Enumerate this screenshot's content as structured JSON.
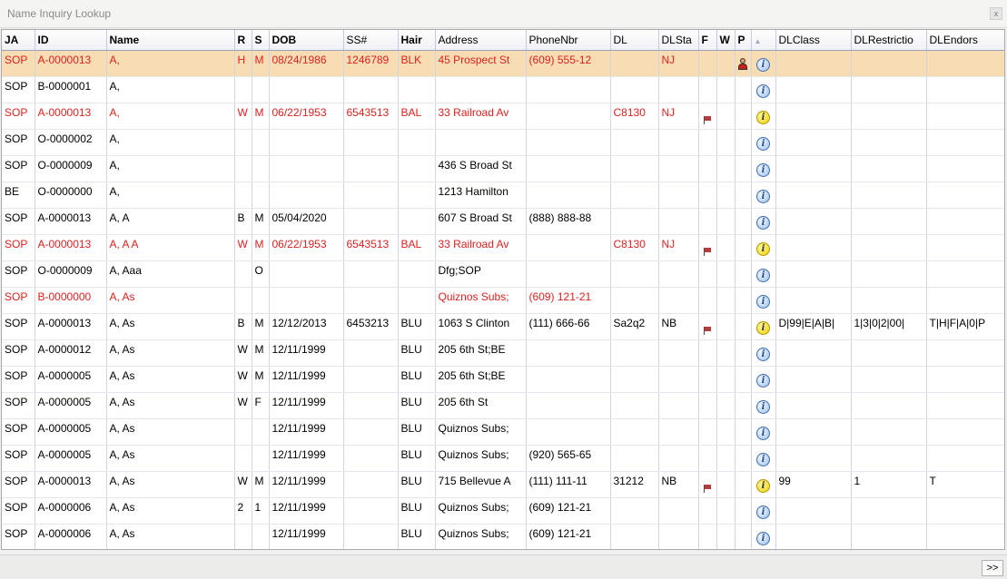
{
  "window": {
    "title": "Name Inquiry Lookup",
    "close_label": "x"
  },
  "colors": {
    "selected_row": "#f8dcb4",
    "alert_text": "#e0201e"
  },
  "columns": [
    {
      "label": "JA",
      "bold": true
    },
    {
      "label": "ID",
      "bold": true
    },
    {
      "label": "Name",
      "bold": true
    },
    {
      "label": "R",
      "bold": true
    },
    {
      "label": "S",
      "bold": true
    },
    {
      "label": "DOB",
      "bold": true
    },
    {
      "label": "SS#",
      "bold": false
    },
    {
      "label": "Hair",
      "bold": true
    },
    {
      "label": "Address",
      "bold": false
    },
    {
      "label": "PhoneNbr",
      "bold": false
    },
    {
      "label": "DL",
      "bold": false
    },
    {
      "label": "DLSta",
      "bold": false
    },
    {
      "label": "F",
      "bold": true
    },
    {
      "label": "W",
      "bold": true
    },
    {
      "label": "P",
      "bold": true
    },
    {
      "label": "",
      "bold": false,
      "sort_icon": "sort-ascending-icon"
    },
    {
      "label": "DLClass",
      "bold": false
    },
    {
      "label": "DLRestrictio",
      "bold": false
    },
    {
      "label": "DLEndors",
      "bold": false
    }
  ],
  "rows": [
    {
      "style": "selected-red",
      "ja": "SOP",
      "id": "A-0000013",
      "name": "A,",
      "r": "H",
      "s": "M",
      "dob": "08/24/1986",
      "ss": "1246789",
      "hair": "BLK",
      "address": "45 Prospect St",
      "phone": "(609) 555-12",
      "dl": "",
      "dlsta": "NJ",
      "f": "",
      "w": "",
      "p": "person-icon",
      "info": "blue",
      "dlclass": "",
      "dlrestr": "",
      "dlendors": ""
    },
    {
      "style": "normal",
      "ja": "SOP",
      "id": "B-0000001",
      "name": "A,",
      "r": "",
      "s": "",
      "dob": "",
      "ss": "",
      "hair": "",
      "address": "",
      "phone": "",
      "dl": "",
      "dlsta": "",
      "f": "",
      "w": "",
      "p": "",
      "info": "blue",
      "dlclass": "",
      "dlrestr": "",
      "dlendors": ""
    },
    {
      "style": "red",
      "ja": "SOP",
      "id": "A-0000013",
      "name": "A,",
      "r": "W",
      "s": "M",
      "dob": "06/22/1953",
      "ss": "6543513",
      "hair": "BAL",
      "address": "33 Railroad Av",
      "phone": "",
      "dl": "C8130",
      "dlsta": "NJ",
      "f": "flag-icon",
      "w": "",
      "p": "",
      "info": "yellow",
      "dlclass": "",
      "dlrestr": "",
      "dlendors": ""
    },
    {
      "style": "normal",
      "ja": "SOP",
      "id": "O-0000002",
      "name": "A,",
      "r": "",
      "s": "",
      "dob": "",
      "ss": "",
      "hair": "",
      "address": "",
      "phone": "",
      "dl": "",
      "dlsta": "",
      "f": "",
      "w": "",
      "p": "",
      "info": "blue",
      "dlclass": "",
      "dlrestr": "",
      "dlendors": ""
    },
    {
      "style": "normal",
      "ja": "SOP",
      "id": "O-0000009",
      "name": "A,",
      "r": "",
      "s": "",
      "dob": "",
      "ss": "",
      "hair": "",
      "address": "436 S Broad St",
      "phone": "",
      "dl": "",
      "dlsta": "",
      "f": "",
      "w": "",
      "p": "",
      "info": "blue",
      "dlclass": "",
      "dlrestr": "",
      "dlendors": ""
    },
    {
      "style": "normal",
      "ja": "BE",
      "id": "O-0000000",
      "name": "A,",
      "r": "",
      "s": "",
      "dob": "",
      "ss": "",
      "hair": "",
      "address": "1213 Hamilton",
      "phone": "",
      "dl": "",
      "dlsta": "",
      "f": "",
      "w": "",
      "p": "",
      "info": "blue",
      "dlclass": "",
      "dlrestr": "",
      "dlendors": ""
    },
    {
      "style": "normal",
      "ja": "SOP",
      "id": "A-0000013",
      "name": "A, A",
      "r": "B",
      "s": "M",
      "dob": "05/04/2020",
      "ss": "",
      "hair": "",
      "address": "607 S Broad St",
      "phone": "(888) 888-88",
      "dl": "",
      "dlsta": "",
      "f": "",
      "w": "",
      "p": "",
      "info": "blue",
      "dlclass": "",
      "dlrestr": "",
      "dlendors": ""
    },
    {
      "style": "red",
      "ja": "SOP",
      "id": "A-0000013",
      "name": "A, A A",
      "r": "W",
      "s": "M",
      "dob": "06/22/1953",
      "ss": "6543513",
      "hair": "BAL",
      "address": "33 Railroad Av",
      "phone": "",
      "dl": "C8130",
      "dlsta": "NJ",
      "f": "flag-icon",
      "w": "",
      "p": "",
      "info": "yellow",
      "dlclass": "",
      "dlrestr": "",
      "dlendors": ""
    },
    {
      "style": "normal",
      "ja": "SOP",
      "id": "O-0000009",
      "name": "A, Aaa",
      "r": "",
      "s": "O",
      "dob": "",
      "ss": "",
      "hair": "",
      "address": "Dfg;SOP",
      "phone": "",
      "dl": "",
      "dlsta": "",
      "f": "",
      "w": "",
      "p": "",
      "info": "blue",
      "dlclass": "",
      "dlrestr": "",
      "dlendors": ""
    },
    {
      "style": "red",
      "ja": "SOP",
      "id": "B-0000000",
      "name": "A, As",
      "r": "",
      "s": "",
      "dob": "",
      "ss": "",
      "hair": "",
      "address": "Quiznos Subs;",
      "phone": "(609) 121-21",
      "dl": "",
      "dlsta": "",
      "f": "",
      "w": "",
      "p": "",
      "info": "blue",
      "dlclass": "",
      "dlrestr": "",
      "dlendors": ""
    },
    {
      "style": "normal",
      "ja": "SOP",
      "id": "A-0000013",
      "name": "A, As",
      "r": "B",
      "s": "M",
      "dob": "12/12/2013",
      "ss": "6453213",
      "hair": "BLU",
      "address": "1063 S Clinton",
      "phone": "(111) 666-66",
      "dl": "Sa2q2",
      "dlsta": "NB",
      "f": "flag-icon",
      "w": "",
      "p": "",
      "info": "yellow",
      "dlclass": "D|99|E|A|B|",
      "dlrestr": "1|3|0|2|00|",
      "dlendors": "T|H|F|A|0|P"
    },
    {
      "style": "normal",
      "ja": "SOP",
      "id": "A-0000012",
      "name": "A, As",
      "r": "W",
      "s": "M",
      "dob": "12/11/1999",
      "ss": "",
      "hair": "BLU",
      "address": "205 6th St;BE",
      "phone": "",
      "dl": "",
      "dlsta": "",
      "f": "",
      "w": "",
      "p": "",
      "info": "blue",
      "dlclass": "",
      "dlrestr": "",
      "dlendors": ""
    },
    {
      "style": "normal",
      "ja": "SOP",
      "id": "A-0000005",
      "name": "A, As",
      "r": "W",
      "s": "M",
      "dob": "12/11/1999",
      "ss": "",
      "hair": "BLU",
      "address": "205 6th St;BE",
      "phone": "",
      "dl": "",
      "dlsta": "",
      "f": "",
      "w": "",
      "p": "",
      "info": "blue",
      "dlclass": "",
      "dlrestr": "",
      "dlendors": ""
    },
    {
      "style": "normal",
      "ja": "SOP",
      "id": "A-0000005",
      "name": "A, As",
      "r": "W",
      "s": "F",
      "dob": "12/11/1999",
      "ss": "",
      "hair": "BLU",
      "address": "205 6th St",
      "phone": "",
      "dl": "",
      "dlsta": "",
      "f": "",
      "w": "",
      "p": "",
      "info": "blue",
      "dlclass": "",
      "dlrestr": "",
      "dlendors": ""
    },
    {
      "style": "normal",
      "ja": "SOP",
      "id": "A-0000005",
      "name": "A, As",
      "r": "",
      "s": "",
      "dob": "12/11/1999",
      "ss": "",
      "hair": "BLU",
      "address": "Quiznos Subs;",
      "phone": "",
      "dl": "",
      "dlsta": "",
      "f": "",
      "w": "",
      "p": "",
      "info": "blue",
      "dlclass": "",
      "dlrestr": "",
      "dlendors": ""
    },
    {
      "style": "normal",
      "ja": "SOP",
      "id": "A-0000005",
      "name": "A, As",
      "r": "",
      "s": "",
      "dob": "12/11/1999",
      "ss": "",
      "hair": "BLU",
      "address": "Quiznos Subs;",
      "phone": "(920) 565-65",
      "dl": "",
      "dlsta": "",
      "f": "",
      "w": "",
      "p": "",
      "info": "blue",
      "dlclass": "",
      "dlrestr": "",
      "dlendors": ""
    },
    {
      "style": "normal",
      "ja": "SOP",
      "id": "A-0000013",
      "name": "A, As",
      "r": "W",
      "s": "M",
      "dob": "12/11/1999",
      "ss": "",
      "hair": "BLU",
      "address": "715 Bellevue A",
      "phone": "(111) 111-11",
      "dl": "31212",
      "dlsta": "NB",
      "f": "flag-icon",
      "w": "",
      "p": "",
      "info": "yellow",
      "dlclass": "99",
      "dlrestr": "1",
      "dlendors": "T"
    },
    {
      "style": "normal",
      "ja": "SOP",
      "id": "A-0000006",
      "name": "A, As",
      "r": "2",
      "s": "1",
      "dob": "12/11/1999",
      "ss": "",
      "hair": "BLU",
      "address": "Quiznos Subs;",
      "phone": "(609) 121-21",
      "dl": "",
      "dlsta": "",
      "f": "",
      "w": "",
      "p": "",
      "info": "blue",
      "dlclass": "",
      "dlrestr": "",
      "dlendors": ""
    },
    {
      "style": "normal",
      "ja": "SOP",
      "id": "A-0000006",
      "name": "A, As",
      "r": "",
      "s": "",
      "dob": "12/11/1999",
      "ss": "",
      "hair": "BLU",
      "address": "Quiznos Subs;",
      "phone": "(609) 121-21",
      "dl": "",
      "dlsta": "",
      "f": "",
      "w": "",
      "p": "",
      "info": "blue",
      "dlclass": "",
      "dlrestr": "",
      "dlendors": ""
    }
  ],
  "footer": {
    "more_label": ">>"
  }
}
